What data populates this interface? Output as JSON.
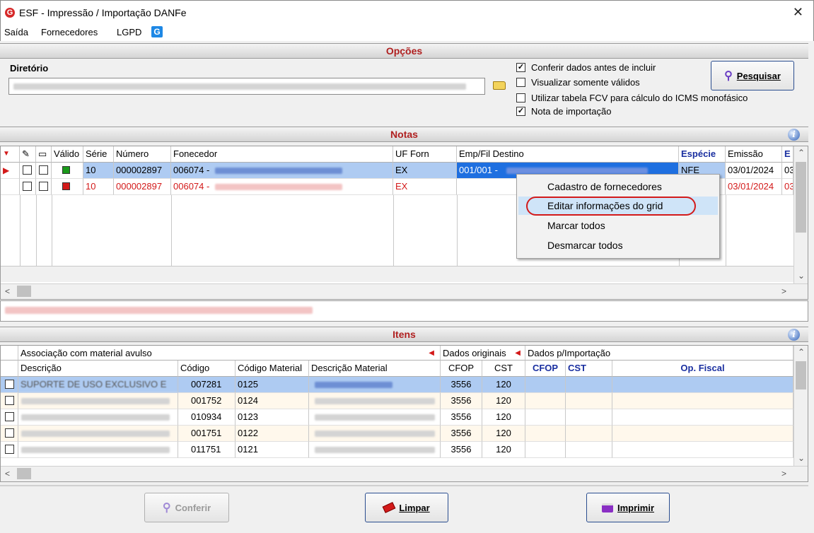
{
  "window": {
    "title": "ESF - Impressão / Importação DANFe",
    "close": "✕"
  },
  "menu": {
    "items": [
      "Saída",
      "Fornecedores",
      "LGPD"
    ]
  },
  "opcoes": {
    "section_title": "Opções",
    "directory_label": "Diretório",
    "options": [
      {
        "label": "Conferir dados antes de incluir",
        "checked": true
      },
      {
        "label": "Visualizar somente válidos",
        "checked": false
      },
      {
        "label": "Utilizar tabela FCV para cálculo do ICMS monofásico",
        "checked": false
      },
      {
        "label": "Nota de importação",
        "checked": true
      }
    ],
    "search_button": "Pesquisar"
  },
  "notas": {
    "section_title": "Notas",
    "columns": [
      "Válido",
      "Série",
      "Número",
      "Fonecedor",
      "UF Forn",
      "Emp/Fil Destino",
      "Espécie",
      "Emissão",
      "E"
    ],
    "rows": [
      {
        "serie": "10",
        "numero": "000002897",
        "fornecedor": "006074 -",
        "uf": "EX",
        "destino": "001/001 -",
        "especie": "NFE",
        "emissao": "03/01/2024",
        "extra": "03",
        "valid": true
      },
      {
        "serie": "10",
        "numero": "000002897",
        "fornecedor": "006074 -",
        "uf": "EX",
        "destino": "",
        "especie": "",
        "emissao": "03/01/2024",
        "extra": "03",
        "valid": false
      }
    ],
    "status_valid_color": "#1a9a1a",
    "status_invalid_color": "#d31a1a"
  },
  "context_menu": {
    "items": [
      "Cadastro de fornecedores",
      "Editar informações do grid",
      "Marcar todos",
      "Desmarcar todos"
    ]
  },
  "itens": {
    "section_title": "Itens",
    "group_headers": [
      "Associação com material avulso",
      "Dados originais",
      "Dados p/Importação"
    ],
    "columns": [
      "Descrição",
      "Código",
      "Código Material",
      "Descrição Material",
      "CFOP",
      "CST",
      "CFOP",
      "CST",
      "Op. Fiscal"
    ],
    "rows": [
      {
        "codigo": "007281",
        "cod_material": "0125",
        "cfop": "3556",
        "cst": "120"
      },
      {
        "codigo": "001752",
        "cod_material": "0124",
        "cfop": "3556",
        "cst": "120"
      },
      {
        "codigo": "010934",
        "cod_material": "0123",
        "cfop": "3556",
        "cst": "120"
      },
      {
        "codigo": "001751",
        "cod_material": "0122",
        "cfop": "3556",
        "cst": "120"
      },
      {
        "codigo": "011751",
        "cod_material": "0121",
        "cfop": "3556",
        "cst": "120"
      }
    ],
    "first_row_desc": "SUPORTE DE USO EXCLUSIVO E"
  },
  "buttons": {
    "conferir": "Conferir",
    "limpar": "Limpar",
    "imprimir": "Imprimir"
  }
}
